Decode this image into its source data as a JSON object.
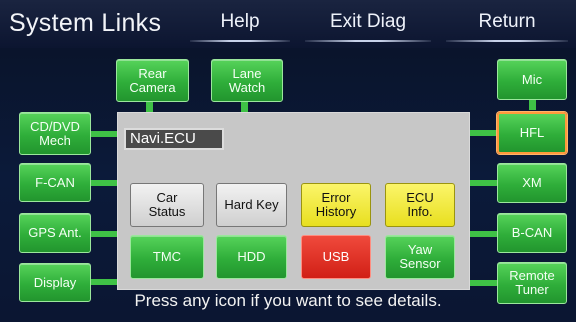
{
  "header": {
    "title": "System Links",
    "help_label": "Help",
    "exit_label": "Exit Diag",
    "return_label": "Return"
  },
  "top_modules": [
    {
      "label": "Rear\nCamera"
    },
    {
      "label": "Lane\nWatch"
    }
  ],
  "left_modules": [
    {
      "label": "CD/DVD\nMech"
    },
    {
      "label": "F-CAN"
    },
    {
      "label": "GPS Ant."
    },
    {
      "label": "Display"
    }
  ],
  "right_modules": [
    {
      "label": "Mic"
    },
    {
      "label": "HFL"
    },
    {
      "label": "XM"
    },
    {
      "label": "B-CAN"
    },
    {
      "label": "Remote\nTuner"
    }
  ],
  "center_panel": {
    "title": "Navi.ECU",
    "row1": [
      {
        "label": "Car\nStatus",
        "color": "gray"
      },
      {
        "label": "Hard Key",
        "color": "gray"
      },
      {
        "label": "Error\nHistory",
        "color": "yellow"
      },
      {
        "label": "ECU\nInfo.",
        "color": "yellow"
      }
    ],
    "row2": [
      {
        "label": "TMC",
        "color": "green"
      },
      {
        "label": "HDD",
        "color": "green"
      },
      {
        "label": "USB",
        "color": "red"
      },
      {
        "label": "Yaw\nSensor",
        "color": "green"
      }
    ]
  },
  "instruction": "Press any icon if you want to see details.",
  "colors": {
    "module_green": "#2fae3a",
    "status_yellow": "#e8df1f",
    "status_red": "#d11f16",
    "selected_border": "#ff9a3c"
  }
}
